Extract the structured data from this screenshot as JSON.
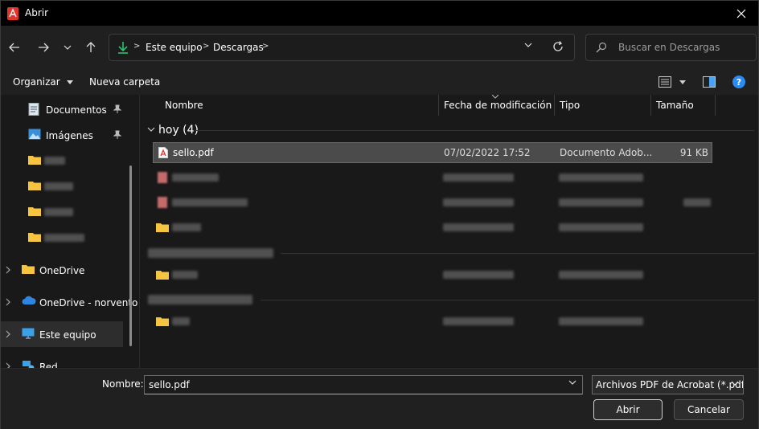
{
  "window": {
    "title": "Abrir",
    "close_label": "✕"
  },
  "address": {
    "crumbs": [
      "Este equipo",
      "Descargas"
    ]
  },
  "search": {
    "placeholder": "Buscar en Descargas"
  },
  "toolbar": {
    "organize_label": "Organizar",
    "new_folder_label": "Nueva carpeta",
    "help_label": "?"
  },
  "sidebar": {
    "quick_items": [
      {
        "label": "Documentos",
        "icon": "documents-icon"
      },
      {
        "label": "Imágenes",
        "icon": "pictures-icon"
      }
    ],
    "tree_items": [
      {
        "label": "OneDrive",
        "icon": "folder-icon"
      },
      {
        "label": "OneDrive - norvento",
        "icon": "cloud-icon"
      },
      {
        "label": "Este equipo",
        "icon": "computer-icon"
      },
      {
        "label": "Red",
        "icon": "network-icon"
      }
    ]
  },
  "columns": {
    "name": "Nombre",
    "date": "Fecha de modificación",
    "type": "Tipo",
    "size": "Tamaño"
  },
  "groups": {
    "today": "hoy (4)"
  },
  "selected_file": {
    "name": "sello.pdf",
    "date": "07/02/2022 17:52",
    "type": "Documento Adob...",
    "size": "91 KB"
  },
  "bottom": {
    "name_label": "Nombre:",
    "filename_value": "sello.pdf",
    "filter_label": "Archivos PDF de Acrobat (*.pdf",
    "open_label": "Abrir",
    "cancel_label": "Cancelar"
  },
  "colors": {
    "accent_download": "#2fbf71",
    "folder_yellow": "#f5c542",
    "pdf_red": "#e2342a",
    "help_blue": "#2a8cf0"
  }
}
